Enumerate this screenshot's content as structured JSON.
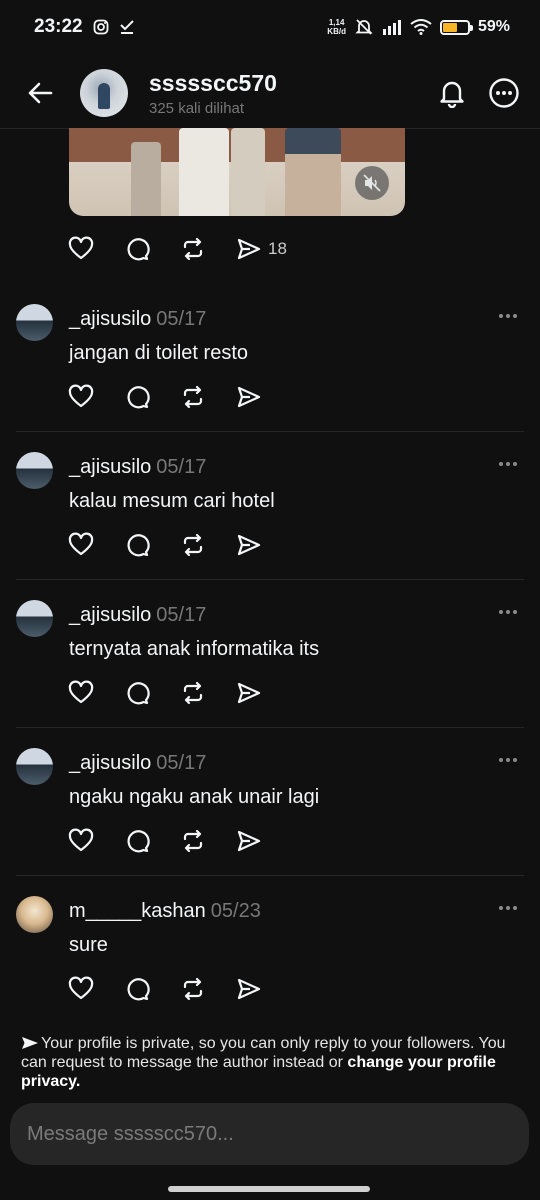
{
  "status_bar": {
    "time": "23:22",
    "net_speed_top": "1,14",
    "net_speed_bottom": "KB/d",
    "battery_percent": "59%",
    "battery_level": 0.59
  },
  "header": {
    "username": "ssssscc570",
    "views": "325 kali dilihat"
  },
  "post_actions": {
    "share_count": "18"
  },
  "comments": [
    {
      "user": "_ajisusilo",
      "date": "05/17",
      "text": "jangan di toilet resto"
    },
    {
      "user": "_ajisusilo",
      "date": "05/17",
      "text": "kalau mesum cari hotel"
    },
    {
      "user": "_ajisusilo",
      "date": "05/17",
      "text": "ternyata anak informatika its"
    },
    {
      "user": "_ajisusilo",
      "date": "05/17",
      "text": "ngaku ngaku anak unair lagi"
    },
    {
      "user": "m_____kashan",
      "date": "05/23",
      "text": "sure"
    }
  ],
  "private_note": {
    "text": "Your profile is private, so you can only reply to your followers. You can request to message the author instead or ",
    "link": "change your profile privacy."
  },
  "composer": {
    "placeholder": "Message ssssscc570..."
  }
}
